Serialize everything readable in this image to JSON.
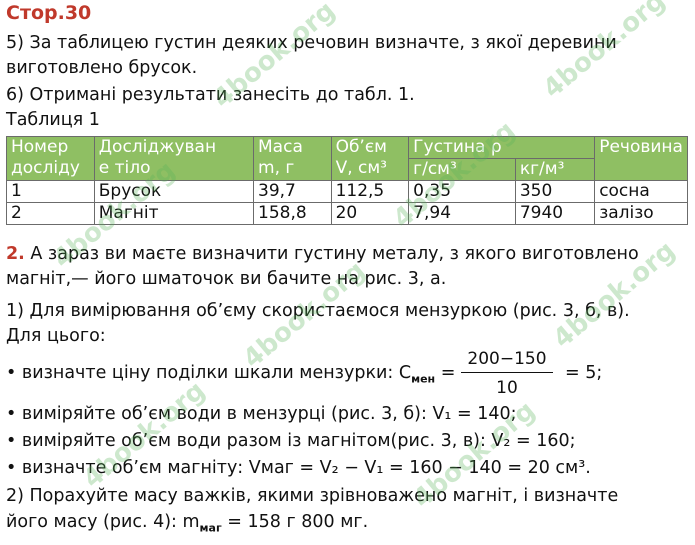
{
  "page_title": "Стор.30",
  "task5": {
    "line1": "5) За таблицею густин деяких речовин визначте, з якої деревини",
    "line2": "виготовлено брусок."
  },
  "task6": "6) Отримані результати занесіть до табл. 1.",
  "table_caption": "Таблиця 1",
  "table": {
    "header": {
      "col1": [
        "Номер",
        "досліду"
      ],
      "col2": [
        "Досліджуван",
        "е тіло"
      ],
      "col3": [
        "Маса",
        "m, г"
      ],
      "col4": [
        "Об’єм",
        "V, см³"
      ],
      "density_title": "Густина ρ",
      "density_unit1": "г/см³",
      "density_unit2": "кг/м³",
      "col7": "Речовина"
    },
    "rows": [
      {
        "n": "1",
        "body": "Брусок",
        "mass": "39,7",
        "volume": "112,5",
        "rho_g": "0,35",
        "rho_kg": "350",
        "substance": "сосна"
      },
      {
        "n": "2",
        "body": "Магніт",
        "mass": "158,8",
        "volume": "20",
        "rho_g": "7,94",
        "rho_kg": "7940",
        "substance": "залізо"
      }
    ]
  },
  "task2": {
    "number": "2.",
    "line1": " А зараз ви маєте визначити густину металу, з якого виготовлено",
    "line2": "магніт,— його шматочок ви бачите на рис. 3, а.",
    "line3": "1) Для вимірювання об’єму скористаємося мензуркою (рис. 3, б, в).",
    "line4": "Для цього:",
    "bullet1_prefix": "• визначте ціну поділки шкали мензурки: C",
    "bullet1_sub": "мен",
    "bullet1_eq": " =",
    "formula_num": "200−150",
    "formula_den": "10",
    "bullet1_suffix": "= 5;",
    "bullet2": "• виміряйте об’єм води в мензурці (рис. 3, б): V₁ = 140;",
    "bullet3": "• виміряйте об’єм води разом із магнітом(рис. 3, в): V₂ = 160;",
    "bullet4": "• визначте об’єм магніту: Vмаг = V₂ − V₁ = 160 − 140 = 20 см³.",
    "line5": "2) Порахуйте масу важків, якими зрівноважено магніт, і визначте",
    "line6_prefix": "його масу (рис. 4): m",
    "line6_sub": "маг",
    "line6_suffix": " = 158 г 800 мг."
  },
  "watermark": "4book.org"
}
